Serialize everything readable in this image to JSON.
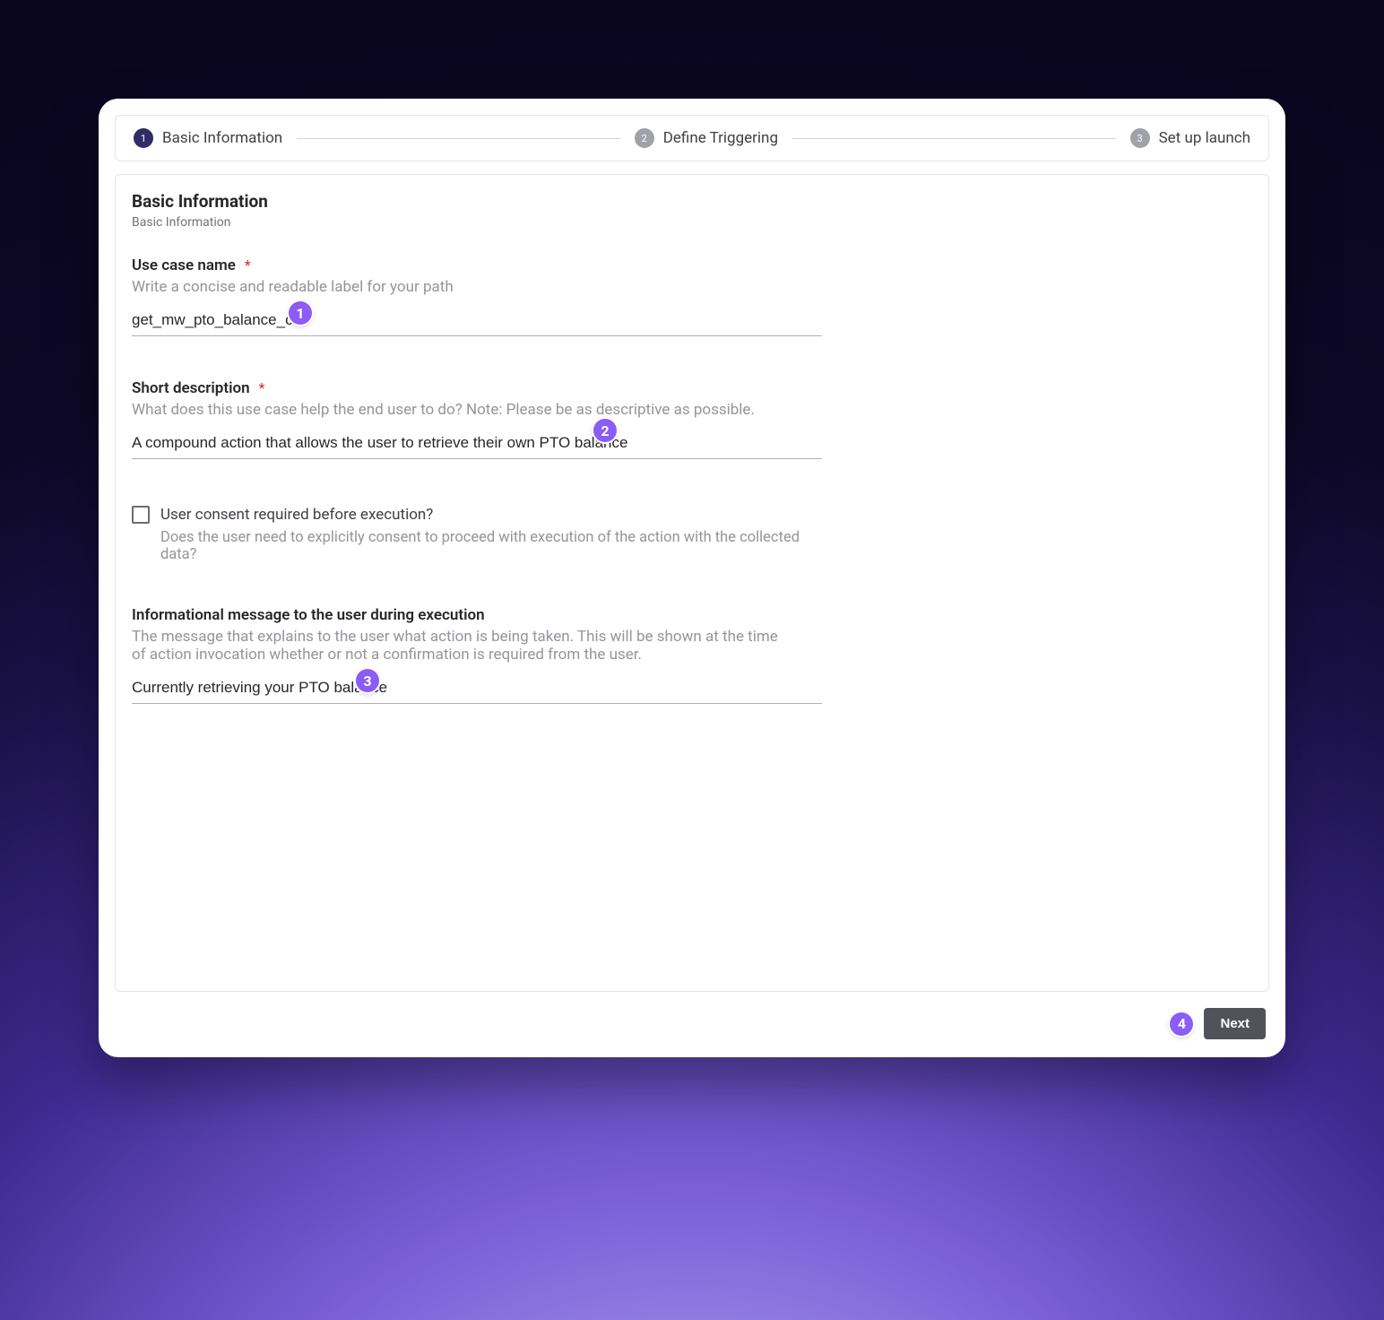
{
  "stepper": {
    "steps": [
      {
        "num": "1",
        "label": "Basic Information",
        "active": true
      },
      {
        "num": "2",
        "label": "Define Triggering",
        "active": false
      },
      {
        "num": "3",
        "label": "Set up launch",
        "active": false
      }
    ]
  },
  "section": {
    "title": "Basic Information",
    "subtitle": "Basic Information"
  },
  "fields": {
    "use_case_name": {
      "label": "Use case name",
      "required_marker": "*",
      "hint": "Write a concise and readable label for your path",
      "value": "get_mw_pto_balance_ca"
    },
    "short_description": {
      "label": "Short description",
      "required_marker": "*",
      "hint": "What does this use case help the end user to do? Note: Please be as descriptive as possible.",
      "value": "A compound action that allows the user to retrieve their own PTO balance"
    },
    "consent": {
      "label": "User consent required before execution?",
      "hint": "Does the user need to explicitly consent to proceed with execution of the action with the collected data?",
      "checked": false
    },
    "info_message": {
      "label": "Informational message to the user during execution",
      "hint": "The message that explains to the user what action is being taken. This will be shown at the time of action invocation whether or not a confirmation is required from the user.",
      "value": "Currently retrieving your PTO balance"
    }
  },
  "footer": {
    "next_label": "Next"
  },
  "annotations": {
    "b1": "1",
    "b2": "2",
    "b3": "3",
    "b4": "4"
  }
}
